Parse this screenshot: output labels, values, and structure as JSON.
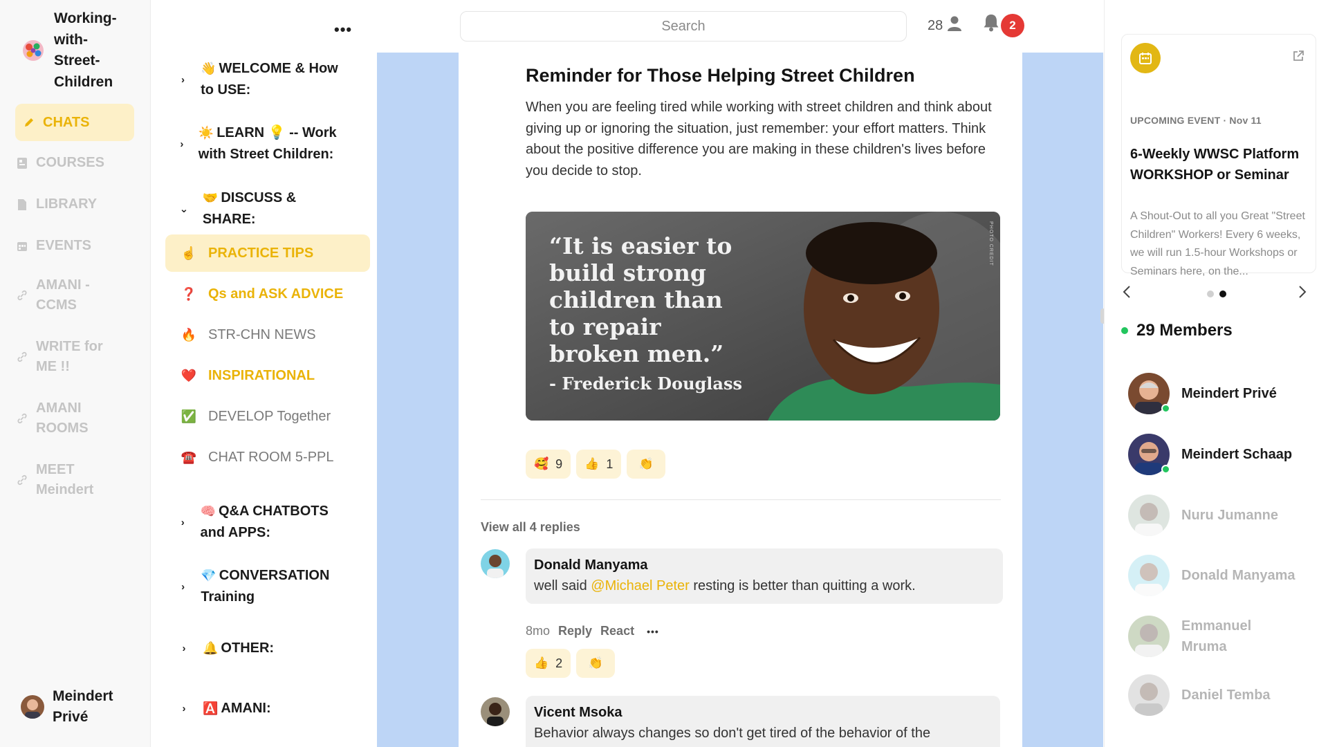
{
  "community": {
    "name": "Working-\nwith-\nStreet-\nChildren"
  },
  "nav": {
    "items": [
      {
        "label": "CHATS",
        "icon": "pencil-icon",
        "active": true
      },
      {
        "label": "COURSES",
        "icon": "book-icon"
      },
      {
        "label": "LIBRARY",
        "icon": "document-icon"
      },
      {
        "label": "EVENTS",
        "icon": "calendar-icon"
      },
      {
        "label": "AMANI -\nCCMS",
        "icon": "link-icon"
      },
      {
        "label": "WRITE for\nME !!",
        "icon": "link-icon"
      },
      {
        "label": "AMANI\nROOMS",
        "icon": "link-icon"
      },
      {
        "label": "MEET\nMeindert",
        "icon": "link-icon"
      }
    ],
    "current_user": "Meindert\nPrivé"
  },
  "channels": {
    "groups": [
      {
        "emoji": "👋",
        "label": "WELCOME & How to USE:",
        "expanded": false
      },
      {
        "emoji": "☀️",
        "label": "LEARN 💡 -- Work with Street Children:",
        "expanded": false
      },
      {
        "emoji": "🤝",
        "label": "DISCUSS & SHARE:",
        "expanded": true
      },
      {
        "emoji": "🧠",
        "label": "Q&A CHATBOTS and APPS:",
        "expanded": false
      },
      {
        "emoji": "💎",
        "label": "CONVERSATION Training",
        "expanded": false
      },
      {
        "emoji": "🔔",
        "label": "OTHER:",
        "expanded": false
      },
      {
        "emoji": "🅰️",
        "label": "AMANI:",
        "expanded": false
      }
    ],
    "items": [
      {
        "icon": "☝️",
        "label": "PRACTICE TIPS",
        "state": "active"
      },
      {
        "icon": "❓",
        "label": "Qs and ASK ADVICE",
        "state": "unread"
      },
      {
        "icon": "🔥",
        "label": "STR-CHN NEWS",
        "state": "read"
      },
      {
        "icon": "❤️",
        "label": "INSPIRATIONAL",
        "state": "unread"
      },
      {
        "icon": "✅",
        "label": "DEVELOP Together",
        "state": "read"
      },
      {
        "icon": "☎️",
        "label": "CHAT ROOM 5-PPL",
        "state": "read"
      }
    ]
  },
  "topbar": {
    "search_placeholder": "Search",
    "online_count": "28",
    "notification_count": "2"
  },
  "post": {
    "title": "Reminder for Those Helping Street Children",
    "body": "When you are feeling tired while working with street children and think about giving up or ignoring the situation, just remember: your effort matters. Think about the positive difference you are making in these children's lives before you decide to stop.",
    "image": {
      "quote": "“It is easier to\nbuild strong\nchildren than\nto repair\nbroken men.”",
      "author": "- Frederick Douglass",
      "credit": "PHOTO CREDIT"
    },
    "reactions": [
      {
        "emoji": "🥰",
        "count": "9"
      },
      {
        "emoji": "👍",
        "count": "1"
      },
      {
        "emoji": "👏",
        "count": ""
      }
    ],
    "view_replies": "View all 4 replies"
  },
  "replies": [
    {
      "author": "Donald Manyama",
      "text_before": "well said ",
      "mention": "@Michael Peter",
      "text_after": " resting is better than quitting a work.",
      "time": "8mo",
      "reply_label": "Reply",
      "react_label": "React",
      "more": "•••",
      "reactions": [
        {
          "emoji": "👍",
          "count": "2"
        },
        {
          "emoji": "👏",
          "count": ""
        }
      ]
    },
    {
      "author": "Vicent Msoka",
      "text": "Behavior always changes so don't get tired of the behavior of the"
    }
  ],
  "event": {
    "kicker": "UPCOMING EVENT · Nov 11",
    "title": "6-Weekly WWSC Platform WORKSHOP or Seminar",
    "description": "A Shout-Out to all you Great \"Street Children\" Workers! Every 6 weeks, we will run 1.5-hour Workshops or Seminars here, on the..."
  },
  "members": {
    "title": "29 Members",
    "list": [
      {
        "name": "Meindert Privé",
        "online": true
      },
      {
        "name": "Meindert Schaap",
        "online": true
      },
      {
        "name": "Nuru Jumanne",
        "online": false
      },
      {
        "name": "Donald Manyama",
        "online": false
      },
      {
        "name": "Emmanuel Mruma",
        "online": false
      },
      {
        "name": "Daniel Temba",
        "online": false
      }
    ]
  },
  "colors": {
    "accent": "#eab308",
    "accent_bg": "#fdf0c8",
    "main_bg": "#bdd5f6",
    "badge": "#e53935",
    "online": "#22c55e"
  }
}
